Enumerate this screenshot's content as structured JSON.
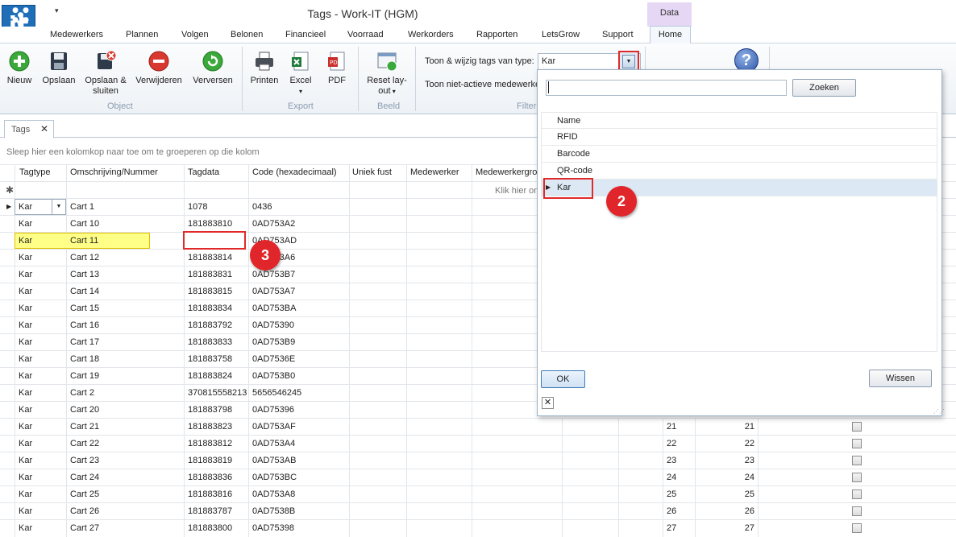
{
  "window": {
    "title": "Tags - Work-IT (HGM)",
    "context_tab": "Data",
    "logo_text": "it"
  },
  "menu": [
    "Medewerkers",
    "Plannen",
    "Volgen",
    "Belonen",
    "Financieel",
    "Voorraad",
    "Werkorders",
    "Rapporten",
    "LetsGrow",
    "Support",
    "Home"
  ],
  "ribbon": {
    "buttons": {
      "nieuw": "Nieuw",
      "opslaan": "Opslaan",
      "opslaan_sluiten": "Opslaan & sluiten",
      "verwijderen": "Verwijderen",
      "verversen": "Verversen",
      "printen": "Printen",
      "excel": "Excel",
      "pdf": "PDF",
      "reset_layout": "Reset lay-out"
    },
    "groups": {
      "object": "Object",
      "export": "Export",
      "beeld": "Beeld",
      "filter": "Filter"
    },
    "filter": {
      "type_label": "Toon & wijzig tags van type:",
      "type_value": "Kar",
      "inactive_label": "Toon niet-actieve medewerke"
    }
  },
  "doc_tab": {
    "label": "Tags"
  },
  "grid": {
    "group_hint": "Sleep hier een kolomkop naar toe om te groeperen op die kolom",
    "new_row_hint": "Klik hier om",
    "columns": [
      "Tagtype",
      "Omschrijving/Nummer",
      "Tagdata",
      "Code (hexadecimaal)",
      "Uniek fust",
      "Medewerker",
      "Medewerkergro"
    ],
    "rows": [
      {
        "tagtype": "Kar",
        "omschrijving": "Cart 1",
        "tagdata": "1078",
        "code": "0436",
        "n1": "",
        "n2": ""
      },
      {
        "tagtype": "Kar",
        "omschrijving": "Cart 10",
        "tagdata": "181883810",
        "code": "0AD753A2",
        "n1": "",
        "n2": ""
      },
      {
        "tagtype": "Kar",
        "omschrijving": "Cart 11",
        "tagdata": "",
        "code": "0AD753AD",
        "n1": "",
        "n2": ""
      },
      {
        "tagtype": "Kar",
        "omschrijving": "Cart 12",
        "tagdata": "181883814",
        "code": "0AD753A6",
        "n1": "",
        "n2": ""
      },
      {
        "tagtype": "Kar",
        "omschrijving": "Cart 13",
        "tagdata": "181883831",
        "code": "0AD753B7",
        "n1": "",
        "n2": ""
      },
      {
        "tagtype": "Kar",
        "omschrijving": "Cart 14",
        "tagdata": "181883815",
        "code": "0AD753A7",
        "n1": "",
        "n2": ""
      },
      {
        "tagtype": "Kar",
        "omschrijving": "Cart 15",
        "tagdata": "181883834",
        "code": "0AD753BA",
        "n1": "",
        "n2": ""
      },
      {
        "tagtype": "Kar",
        "omschrijving": "Cart 16",
        "tagdata": "181883792",
        "code": "0AD75390",
        "n1": "",
        "n2": ""
      },
      {
        "tagtype": "Kar",
        "omschrijving": "Cart 17",
        "tagdata": "181883833",
        "code": "0AD753B9",
        "n1": "",
        "n2": ""
      },
      {
        "tagtype": "Kar",
        "omschrijving": "Cart 18",
        "tagdata": "181883758",
        "code": "0AD7536E",
        "n1": "",
        "n2": ""
      },
      {
        "tagtype": "Kar",
        "omschrijving": "Cart 19",
        "tagdata": "181883824",
        "code": "0AD753B0",
        "n1": "",
        "n2": ""
      },
      {
        "tagtype": "Kar",
        "omschrijving": "Cart 2",
        "tagdata": "370815558213",
        "code": "5656546245",
        "n1": "",
        "n2": ""
      },
      {
        "tagtype": "Kar",
        "omschrijving": "Cart 20",
        "tagdata": "181883798",
        "code": "0AD75396",
        "n1": "",
        "n2": ""
      },
      {
        "tagtype": "Kar",
        "omschrijving": "Cart 21",
        "tagdata": "181883823",
        "code": "0AD753AF",
        "n1": "21",
        "n2": "21"
      },
      {
        "tagtype": "Kar",
        "omschrijving": "Cart 22",
        "tagdata": "181883812",
        "code": "0AD753A4",
        "n1": "22",
        "n2": "22"
      },
      {
        "tagtype": "Kar",
        "omschrijving": "Cart 23",
        "tagdata": "181883819",
        "code": "0AD753AB",
        "n1": "23",
        "n2": "23"
      },
      {
        "tagtype": "Kar",
        "omschrijving": "Cart 24",
        "tagdata": "181883836",
        "code": "0AD753BC",
        "n1": "24",
        "n2": "24"
      },
      {
        "tagtype": "Kar",
        "omschrijving": "Cart 25",
        "tagdata": "181883816",
        "code": "0AD753A8",
        "n1": "25",
        "n2": "25"
      },
      {
        "tagtype": "Kar",
        "omschrijving": "Cart 26",
        "tagdata": "181883787",
        "code": "0AD7538B",
        "n1": "26",
        "n2": "26"
      },
      {
        "tagtype": "Kar",
        "omschrijving": "Cart 27",
        "tagdata": "181883800",
        "code": "0AD75398",
        "n1": "27",
        "n2": "27"
      }
    ]
  },
  "popup": {
    "search_value": "",
    "search_button": "Zoeken",
    "list_header": "Name",
    "items": [
      "RFID",
      "Barcode",
      "QR-code",
      "Kar"
    ],
    "selected": "Kar",
    "ok_button": "OK",
    "clear_button": "Wissen",
    "close_glyph": "✕"
  },
  "markers": {
    "two": "2",
    "three": "3"
  },
  "colors": {
    "marker_red": "#e0262a",
    "highlight_yellow": "#ffff88",
    "selection_blue": "#dce9f5",
    "context_tab": "#e6d7f4"
  }
}
